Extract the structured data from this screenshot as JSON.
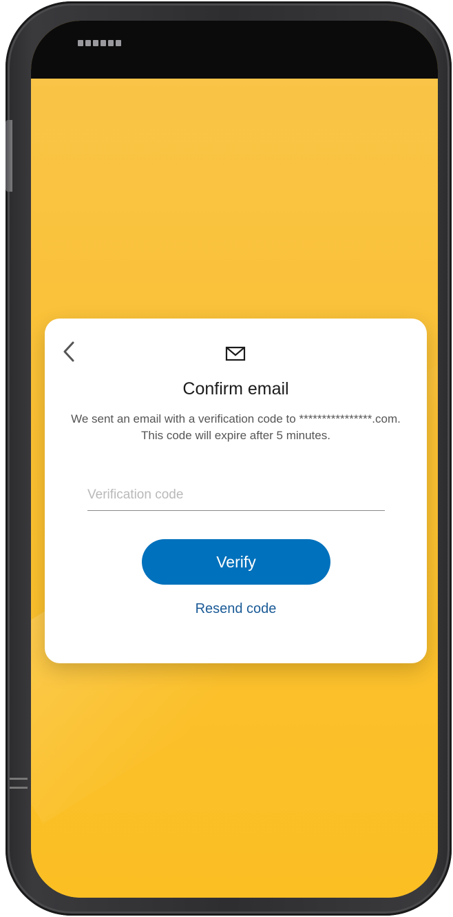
{
  "dialog": {
    "title": "Confirm email",
    "message": "We sent an email with a verification code to ****************.com. This code will expire after 5 minutes.",
    "input": {
      "placeholder": "Verification code",
      "value": ""
    },
    "verify_label": "Verify",
    "resend_label": "Resend code"
  },
  "icons": {
    "back": "chevron-left-icon",
    "mail": "envelope-icon"
  },
  "colors": {
    "background": "#fbbf24",
    "primary_button": "#0071bc",
    "link": "#1a5a96"
  }
}
